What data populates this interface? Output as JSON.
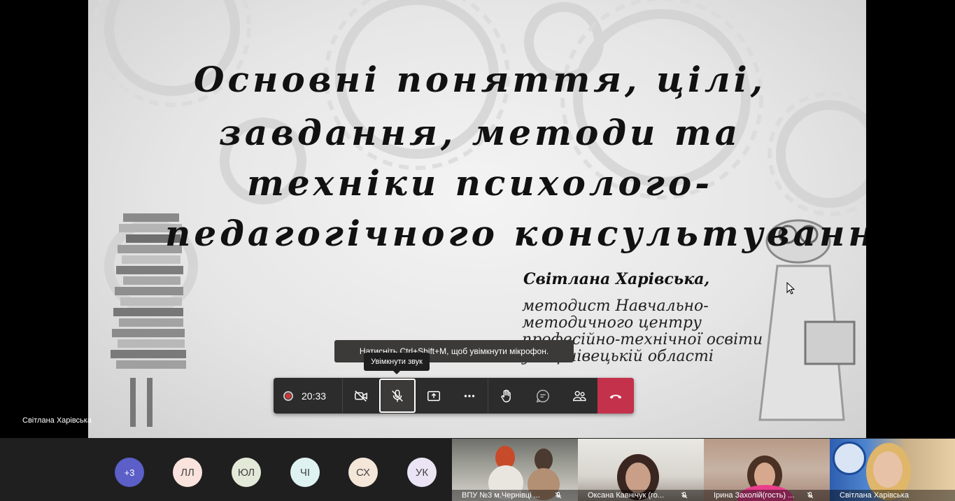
{
  "slide": {
    "title_lines": [
      "Основні поняття, цілі,",
      "завдання, методи та",
      "техніки психолого-",
      "педагогічного консультування"
    ],
    "author_name": "Світлана Харівська,",
    "author_role_lines": [
      "методист Навчально-",
      "методичного центру",
      "професійно-технічної освіти",
      "у Чернівецькій області"
    ]
  },
  "presenter": {
    "name": "Світлана Харівська"
  },
  "tooltips": {
    "shortcut": "Натисніть Ctrl+Shift+M, щоб увімкнути мікрофон.",
    "unmute": "Увімкнути звук"
  },
  "toolbar": {
    "timer": "20:33",
    "record_color": "#d13438",
    "hangup_color": "#c4314b",
    "buttons": [
      "camera-off-icon",
      "mic-off-icon",
      "share-tray-icon",
      "more-icon",
      "raise-hand-icon",
      "chat-icon",
      "participants-icon",
      "hang-up-icon"
    ]
  },
  "participants": {
    "overflow": "+3",
    "avatars": [
      "ЛЛ",
      "ЮЛ",
      "ЧІ",
      "СХ",
      "УК"
    ],
    "video_tiles": [
      {
        "label": "ВПУ №3 м.Чернівці ..."
      },
      {
        "label": "Оксана Кавнічук (го..."
      },
      {
        "label": "Ірина Захолій(гость) ..."
      },
      {
        "label": "Світлана Харівська"
      }
    ]
  }
}
